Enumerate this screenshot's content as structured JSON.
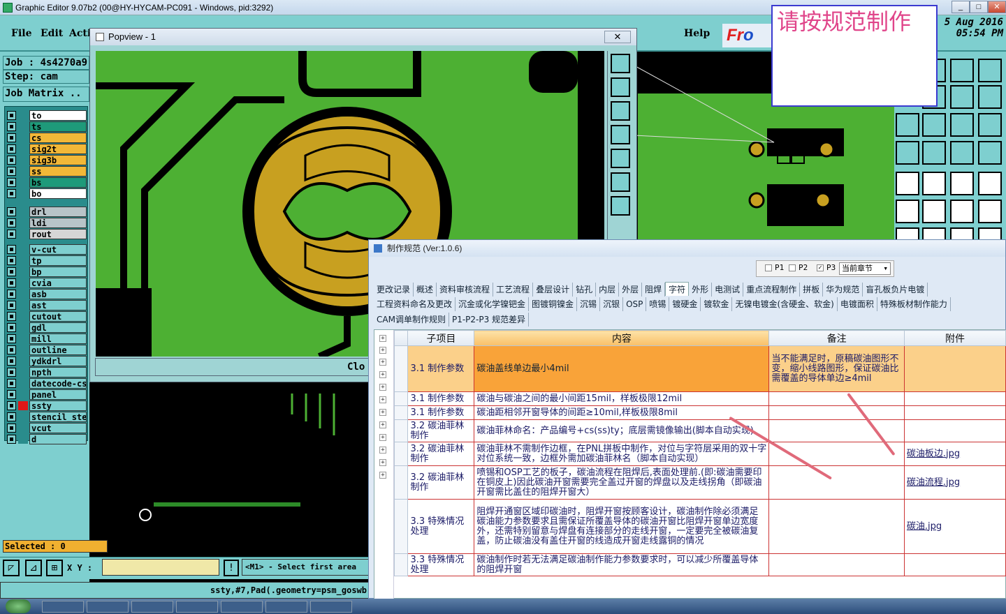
{
  "app": {
    "window_title": "Graphic Editor 9.07b2 (00@HY-HYCAM-PC091 - Windows, pid:3292)",
    "menus": [
      "File",
      "Edit",
      "Acti"
    ],
    "help": "Help",
    "logo": {
      "red": "Fr",
      "blue": "o"
    },
    "date_line1": "5 Aug 2016",
    "date_line2": "05:54 PM"
  },
  "job": {
    "job_label": "Job : 4s4270a9",
    "step_label": "Step: cam",
    "matrix_button": "Job Matrix .."
  },
  "layers": [
    {
      "name": "to",
      "bg": "#ffffff",
      "sw": "#2a8c8c"
    },
    {
      "name": "ts",
      "bg": "#1e9a7a",
      "sw": "#2a8c8c"
    },
    {
      "name": "cs",
      "bg": "#f2b838",
      "sw": "#2a8c8c"
    },
    {
      "name": "sig2t",
      "bg": "#f2b838",
      "sw": "#2a8c8c"
    },
    {
      "name": "sig3b",
      "bg": "#f2b838",
      "sw": "#2a8c8c"
    },
    {
      "name": "ss",
      "bg": "#f2b838",
      "sw": "#2a8c8c"
    },
    {
      "name": "bs",
      "bg": "#1e9a7a",
      "sw": "#2a8c8c"
    },
    {
      "name": "bo",
      "bg": "#ffffff",
      "sw": "#2a8c8c"
    },
    {
      "name": "drl",
      "bg": "#b8c4c8",
      "sw": "#2a8c8c"
    },
    {
      "name": "ldi",
      "bg": "#b8c4c8",
      "sw": "#2a8c8c"
    },
    {
      "name": "rout",
      "bg": "#d6d6d6",
      "sw": "#2a8c8c"
    },
    {
      "name": "v-cut",
      "bg": "#7ecfcf",
      "sw": "#2a8c8c"
    },
    {
      "name": "tp",
      "bg": "#7ecfcf",
      "sw": "#2a8c8c"
    },
    {
      "name": "bp",
      "bg": "#7ecfcf",
      "sw": "#2a8c8c"
    },
    {
      "name": "cvia",
      "bg": "#7ecfcf",
      "sw": "#2a8c8c"
    },
    {
      "name": "asb",
      "bg": "#7ecfcf",
      "sw": "#2a8c8c"
    },
    {
      "name": "ast",
      "bg": "#7ecfcf",
      "sw": "#2a8c8c"
    },
    {
      "name": "cutout",
      "bg": "#7ecfcf",
      "sw": "#2a8c8c"
    },
    {
      "name": "gdl",
      "bg": "#7ecfcf",
      "sw": "#2a8c8c"
    },
    {
      "name": "mill",
      "bg": "#7ecfcf",
      "sw": "#2a8c8c"
    },
    {
      "name": "outline",
      "bg": "#7ecfcf",
      "sw": "#2a8c8c"
    },
    {
      "name": "ydkdrl",
      "bg": "#7ecfcf",
      "sw": "#2a8c8c"
    },
    {
      "name": "npth",
      "bg": "#7ecfcf",
      "sw": "#2a8c8c"
    },
    {
      "name": "datecode-cs",
      "bg": "#7ecfcf",
      "sw": "#2a8c8c"
    },
    {
      "name": "panel",
      "bg": "#7ecfcf",
      "sw": "#2a8c8c"
    },
    {
      "name": "ssty",
      "bg": "#7ecfcf",
      "sw": "#e01818"
    },
    {
      "name": "stencil_step",
      "bg": "#7ecfcf",
      "sw": "#2a8c8c"
    },
    {
      "name": "vcut",
      "bg": "#7ecfcf",
      "sw": "#2a8c8c"
    },
    {
      "name": "d",
      "bg": "#7ecfcf",
      "sw": "#2a8c8c"
    }
  ],
  "status": {
    "selected": "Selected : 0",
    "xy_label": "X Y :",
    "message": "<M1> - Select first area",
    "command": "ssty,#7,Pad(.geometry=psm_goswb"
  },
  "popview": {
    "title": "Popview - 1",
    "close": "Clo"
  },
  "note": "请按规范制作",
  "spec": {
    "title": "制作规范 (Ver:1.0.6)",
    "p_labels": [
      "P1",
      "P2",
      "P3"
    ],
    "section_select": "当前章节",
    "tabs_row1": [
      "更改记录",
      "概述",
      "资料审核流程",
      "工艺流程",
      "叠层设计",
      "钻孔",
      "内层",
      "外层",
      "阻焊",
      "字符",
      "外形",
      "电测试",
      "重点流程制作",
      "拼板",
      "华为规范",
      "盲孔板负片电镀"
    ],
    "tabs_row2": [
      "工程资料命名及更改",
      "沉金或化学镍钯金",
      "图镀铜镍金",
      "沉锡",
      "沉银",
      "OSP",
      "喷锡",
      "镀硬金",
      "镀软金",
      "无镍电镀金(含硬金、软金)",
      "电镀面积",
      "特殊板材制作能力"
    ],
    "tabs_row3": [
      "CAM调单制作规则",
      "P1-P2-P3 规范差异"
    ],
    "active_tab": "字符",
    "columns": [
      "子项目",
      "内容",
      "备注",
      "附件"
    ],
    "rows": [
      {
        "item": "3.1 制作参数",
        "content": "碳油盖线单边最小4mil",
        "note": "当不能满足时，原稿碳油图形不变，缩小线路图形，保证碳油比需覆盖的导体单边≥4mil",
        "attach": ""
      },
      {
        "item": "3.1 制作参数",
        "content": "碳油与碳油之间的最小间距15mil，样板极限12mil",
        "note": "",
        "attach": ""
      },
      {
        "item": "3.1 制作参数",
        "content": "碳油距相邻开窗导体的间距≥10mil,样板极限8mil",
        "note": "",
        "attach": ""
      },
      {
        "item": "3.2 碳油菲林制作",
        "content": "碳油菲林命名：产品编号+cs(ss)ty；底层需镜像输出(脚本自动实现)",
        "note": "",
        "attach": ""
      },
      {
        "item": "3.2 碳油菲林制作",
        "content": "碳油菲林不需制作边框，在PNL拼板中制作，对位与字符层采用的双十字对位系统一致，边框外需加碳油菲林名（脚本自动实现）",
        "note": "",
        "attach": "碳油板边.jpg"
      },
      {
        "item": "3.2 碳油菲林制作",
        "content": "喷锡和OSP工艺的板子，碳油流程在阻焊后,表面处理前.(即:碳油需要印在铜皮上)因此碳油开窗需要完全盖过开窗的焊盘以及走线拐角（即碳油开窗需比盖住的阻焊开窗大）",
        "note": "",
        "attach": "碳油流程.jpg"
      },
      {
        "item": "3.3 特殊情况处理",
        "content": "阻焊开通窗区域印碳油时，阻焊开窗按顾客设计，碳油制作除必须满足碳油能力参数要求且需保证所覆盖导体的碳油开窗比阻焊开窗单边宽度外，还需特别留意与焊盘有连接部分的走线开窗，一定要完全被碳油复盖，防止碳油没有盖住开窗的线造成开窗走线露铜的情况",
        "note": "",
        "attach": "碳油.jpg"
      },
      {
        "item": "3.3 特殊情况处理",
        "content": "碳油制作时若无法满足碳油制作能力参数要求时，可以减少所覆盖导体的阻焊开窗",
        "note": "",
        "attach": ""
      }
    ]
  },
  "colors": {
    "cad_bg": "#7ecfcf",
    "pcb_green": "#4db033",
    "pad_gold": "#c8a020",
    "arrow": "#e06a7a",
    "note_text": "#e0458a"
  }
}
